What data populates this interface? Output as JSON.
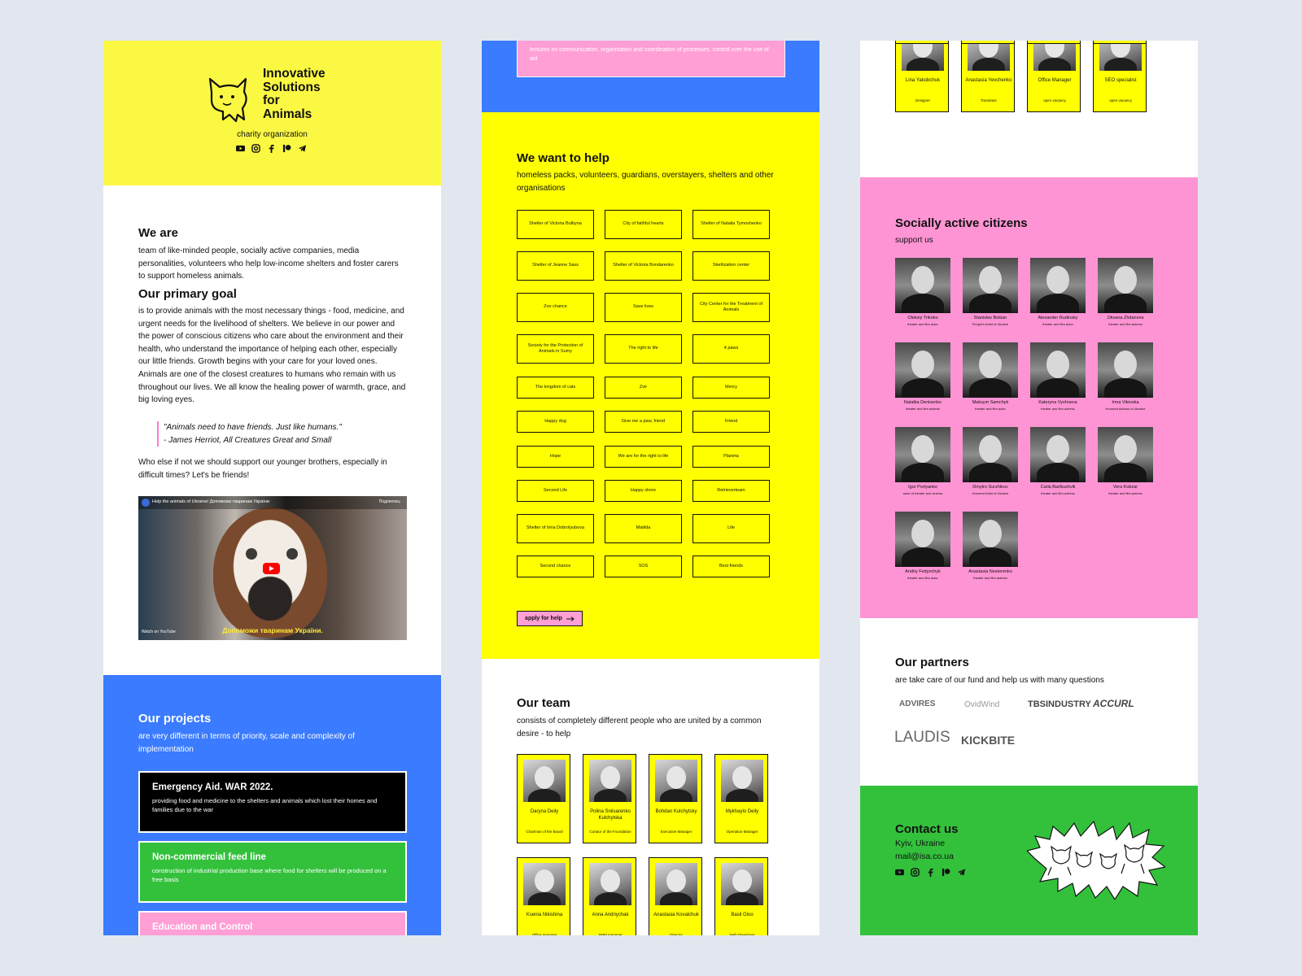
{
  "header": {
    "logo_lines": [
      "Innovative",
      "Solutions",
      "for",
      "Animals"
    ],
    "tagline": "charity organization"
  },
  "social_icons": [
    "youtube-icon",
    "instagram-icon",
    "facebook-icon",
    "patreon-icon",
    "telegram-icon"
  ],
  "about": {
    "we_are_title": "We are",
    "we_are_text": "team of like-minded people, socially active companies, media personalities, volunteers who help low-income shelters and foster carers to support homeless animals.",
    "goal_title": "Our primary goal",
    "goal_text": "is to provide animals with the most necessary things - food, medicine, and urgent needs for the livelihood of shelters. We believe in our power and the power of conscious citizens who care about the environment and their health, who understand the importance of helping each other, especially our little friends. Growth begins with your care for your loved ones. Animals are one of the closest creatures to humans who remain with us throughout our lives. We all know the healing power of warmth, grace, and big loving eyes.",
    "quote_line1": "\"Animals need to have friends. Just like humans.\"",
    "quote_line2": "- James Herriot, All Creatures Great and Small",
    "closing": "Who else if not we should support our younger brothers, especially in difficult times? Let's be friends!"
  },
  "video": {
    "title": "Help the animals of Ukraine/ Допоможи тваринам України",
    "share": "Поділитись",
    "subtitle": "Допоможи тваринам України.",
    "watch_on": "Watch on YouTube"
  },
  "projects": {
    "title": "Our projects",
    "subtitle": "are very different in terms of priority, scale and complexity of implementation",
    "cards": [
      {
        "title": "Emergency Aid. WAR 2022.",
        "desc": "providing food and medicine to the shelters and animals which lost their homes and families due to the war",
        "color": "#000000"
      },
      {
        "title": "Non-commercial feed line",
        "desc": "construction of industrial production base where food for shelters will be produced on a free basis",
        "color": "#33c13c"
      },
      {
        "title": "Education and Control",
        "desc": "lectures on communication, organisation and coordination of processes, control over the use of aid",
        "color": "#ff9fd5"
      }
    ]
  },
  "help": {
    "title": "We want to help",
    "subtitle": "homeless packs, volunteers, guardians, overstayers, shelters and other organisations",
    "orgs": [
      [
        "Shelter of Victoria Bulbyna",
        "City of faithful hearts",
        "Shelter of Natalia Tymoshenko"
      ],
      [
        "Shelter of Jeanne Sass",
        "Shelter of Victoria Bondarenko",
        "Sterilization center"
      ],
      [
        "Zoo chance",
        "Save lives",
        "City Center for the Treatment of Animals"
      ],
      [
        "Society for the Protection of Animals in Sumy",
        "The right to life",
        "4 paws"
      ],
      [
        "The kingdom of cats",
        "Zvir",
        "Mercy"
      ],
      [
        "Happy dog",
        "Give me a paw, friend",
        "Friend"
      ],
      [
        "Hope",
        "We are for the right to life",
        "Planeta"
      ],
      [
        "Second Life",
        "Happy shore",
        "Retrieverteam"
      ],
      [
        "Shelter of Irina Dobrolyubova",
        "Matilda",
        "Life"
      ],
      [
        "Second chance",
        "SOS",
        "Best friends"
      ]
    ],
    "apply_label": "apply for help"
  },
  "team": {
    "title": "Our team",
    "subtitle": "consists of completely different people who are united by a common desire - to help",
    "members": [
      {
        "name": "Daryna Deily",
        "role": "Chairman of the Board"
      },
      {
        "name": "Polina Sniisarenko Kulchytska",
        "role": "Curator of the Foundation"
      },
      {
        "name": "Bohdan Kulchytsky",
        "role": "Executive Manager"
      },
      {
        "name": "Mykhaylo Deily",
        "role": "Operation Manager"
      },
      {
        "name": "Ksenia Nikishina",
        "role": "Office manager"
      },
      {
        "name": "Anna Andriychak",
        "role": "SMM manager"
      },
      {
        "name": "Anastasia Kovalchuk",
        "role": "Director"
      },
      {
        "name": "Basil Gloo",
        "role": "Web Developer"
      }
    ],
    "members_more": [
      {
        "name": "Lina Yakobchuk",
        "role": "Designer"
      },
      {
        "name": "Anastasia Yevchenko",
        "role": "Translator"
      },
      {
        "name": "Office Manager",
        "role": "open vacancy"
      },
      {
        "name": "SEO specialist",
        "role": "open vacancy"
      }
    ]
  },
  "citizens": {
    "title": "Socially active citizens",
    "subtitle": "support us",
    "people": [
      {
        "name": "Oleksiy Trikoko",
        "role": "theater and film actor"
      },
      {
        "name": "Stanislav Boklan",
        "role": "People's Artist of Ukraine"
      },
      {
        "name": "Alexander Rudinsky",
        "role": "theater and film actor"
      },
      {
        "name": "Oksana Zhdanova",
        "role": "theater and film actress"
      },
      {
        "name": "Natalka Denisenko",
        "role": "theater and film actress"
      },
      {
        "name": "Maksym Samchyk",
        "role": "theater and film actor"
      },
      {
        "name": "Kateryna Vyshneva",
        "role": "theater and film actress"
      },
      {
        "name": "Irma Vitovska",
        "role": "Honored Actress of Ukraine"
      },
      {
        "name": "Igor Portyanko",
        "role": "actor of theater and cinema"
      },
      {
        "name": "Dmytro Surzhikov",
        "role": "Honored Artist of Ukraine"
      },
      {
        "name": "Carla Bartkushvili",
        "role": "theater and film actress"
      },
      {
        "name": "Vera Kobzar",
        "role": "theater and film actress"
      },
      {
        "name": "Andriy Fedynchyk",
        "role": "theater and film actor"
      },
      {
        "name": "Anastasia Nesterenko",
        "role": "theater and film actress"
      }
    ]
  },
  "partners": {
    "title": "Our partners",
    "subtitle": "are take care of our fund and help us with many questions",
    "logos": [
      "ADVIRES",
      "OvidWind",
      "TBSINDUSTRY",
      "ACCURL",
      "LAUDIS",
      "KICKBITE"
    ]
  },
  "contact": {
    "title": "Contact us",
    "city": "Kyiv, Ukraine",
    "email": "mail@isa.co.ua"
  },
  "colors": {
    "yellow": "#ffff00",
    "light_yellow": "#fbf843",
    "blue": "#3a7bff",
    "pink": "#ff94d4",
    "green": "#33c13c",
    "black": "#000000"
  }
}
